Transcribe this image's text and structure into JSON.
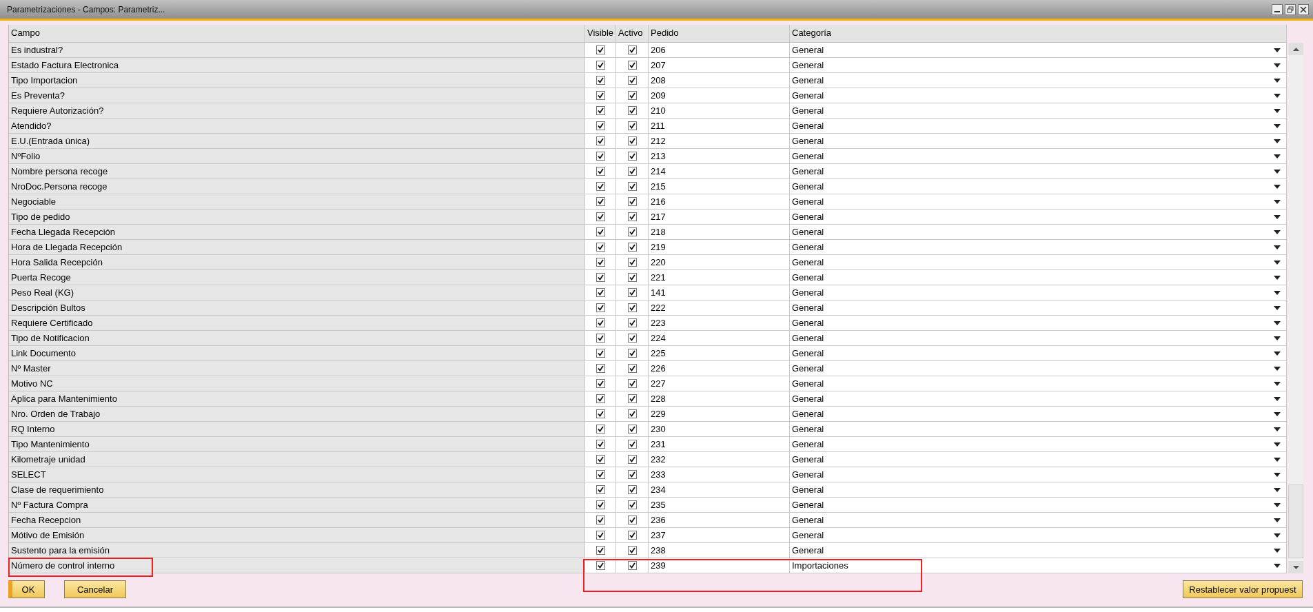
{
  "window": {
    "title": "Parametrizaciones - Campos: Parametriz..."
  },
  "table": {
    "columns": [
      "Campo",
      "Visible",
      "Activo",
      "Pedido",
      "Categoría"
    ],
    "rows": [
      {
        "campo": "Es industral?",
        "visible": true,
        "activo": true,
        "pedido": "206",
        "categoria": "General",
        "highlighted": false
      },
      {
        "campo": "Estado Factura Electronica",
        "visible": true,
        "activo": true,
        "pedido": "207",
        "categoria": "General",
        "highlighted": false
      },
      {
        "campo": "Tipo Importacion",
        "visible": true,
        "activo": true,
        "pedido": "208",
        "categoria": "General",
        "highlighted": false
      },
      {
        "campo": "Es Preventa?",
        "visible": true,
        "activo": true,
        "pedido": "209",
        "categoria": "General",
        "highlighted": false
      },
      {
        "campo": "Requiere Autorización?",
        "visible": true,
        "activo": true,
        "pedido": "210",
        "categoria": "General",
        "highlighted": false
      },
      {
        "campo": "Atendido?",
        "visible": true,
        "activo": true,
        "pedido": "211",
        "categoria": "General",
        "highlighted": false
      },
      {
        "campo": "E.U.(Entrada única)",
        "visible": true,
        "activo": true,
        "pedido": "212",
        "categoria": "General",
        "highlighted": false
      },
      {
        "campo": "NºFolio",
        "visible": true,
        "activo": true,
        "pedido": "213",
        "categoria": "General",
        "highlighted": false
      },
      {
        "campo": "Nombre persona recoge",
        "visible": true,
        "activo": true,
        "pedido": "214",
        "categoria": "General",
        "highlighted": false
      },
      {
        "campo": "NroDoc.Persona recoge",
        "visible": true,
        "activo": true,
        "pedido": "215",
        "categoria": "General",
        "highlighted": false
      },
      {
        "campo": "Negociable",
        "visible": true,
        "activo": true,
        "pedido": "216",
        "categoria": "General",
        "highlighted": false
      },
      {
        "campo": "Tipo de pedido",
        "visible": true,
        "activo": true,
        "pedido": "217",
        "categoria": "General",
        "highlighted": false
      },
      {
        "campo": "Fecha Llegada Recepción",
        "visible": true,
        "activo": true,
        "pedido": "218",
        "categoria": "General",
        "highlighted": false
      },
      {
        "campo": "Hora de Llegada Recepción",
        "visible": true,
        "activo": true,
        "pedido": "219",
        "categoria": "General",
        "highlighted": false
      },
      {
        "campo": "Hora Salida Recepción",
        "visible": true,
        "activo": true,
        "pedido": "220",
        "categoria": "General",
        "highlighted": false
      },
      {
        "campo": "Puerta Recoge",
        "visible": true,
        "activo": true,
        "pedido": "221",
        "categoria": "General",
        "highlighted": false
      },
      {
        "campo": "Peso Real (KG)",
        "visible": true,
        "activo": true,
        "pedido": "141",
        "categoria": "General",
        "highlighted": false
      },
      {
        "campo": "Descripción Bultos",
        "visible": true,
        "activo": true,
        "pedido": "222",
        "categoria": "General",
        "highlighted": false
      },
      {
        "campo": "Requiere Certificado",
        "visible": true,
        "activo": true,
        "pedido": "223",
        "categoria": "General",
        "highlighted": false
      },
      {
        "campo": "Tipo de Notificacion",
        "visible": true,
        "activo": true,
        "pedido": "224",
        "categoria": "General",
        "highlighted": false
      },
      {
        "campo": "Link Documento",
        "visible": true,
        "activo": true,
        "pedido": "225",
        "categoria": "General",
        "highlighted": false
      },
      {
        "campo": "Nº Master",
        "visible": true,
        "activo": true,
        "pedido": "226",
        "categoria": "General",
        "highlighted": false
      },
      {
        "campo": "Motivo NC",
        "visible": true,
        "activo": true,
        "pedido": "227",
        "categoria": "General",
        "highlighted": false
      },
      {
        "campo": "Aplica para Mantenimiento",
        "visible": true,
        "activo": true,
        "pedido": "228",
        "categoria": "General",
        "highlighted": false
      },
      {
        "campo": "Nro. Orden de Trabajo",
        "visible": true,
        "activo": true,
        "pedido": "229",
        "categoria": "General",
        "highlighted": false
      },
      {
        "campo": "RQ Interno",
        "visible": true,
        "activo": true,
        "pedido": "230",
        "categoria": "General",
        "highlighted": false
      },
      {
        "campo": "Tipo Mantenimiento",
        "visible": true,
        "activo": true,
        "pedido": "231",
        "categoria": "General",
        "highlighted": false
      },
      {
        "campo": "Kilometraje unidad",
        "visible": true,
        "activo": true,
        "pedido": "232",
        "categoria": "General",
        "highlighted": false
      },
      {
        "campo": "SELECT",
        "visible": true,
        "activo": true,
        "pedido": "233",
        "categoria": "General",
        "highlighted": false
      },
      {
        "campo": "Clase de requerimiento",
        "visible": true,
        "activo": true,
        "pedido": "234",
        "categoria": "General",
        "highlighted": false
      },
      {
        "campo": "Nº Factura Compra",
        "visible": true,
        "activo": true,
        "pedido": "235",
        "categoria": "General",
        "highlighted": false
      },
      {
        "campo": "Fecha Recepcion",
        "visible": true,
        "activo": true,
        "pedido": "236",
        "categoria": "General",
        "highlighted": false
      },
      {
        "campo": "Mótivo de Emisión",
        "visible": true,
        "activo": true,
        "pedido": "237",
        "categoria": "General",
        "highlighted": false
      },
      {
        "campo": "Sustento para la emisión",
        "visible": true,
        "activo": true,
        "pedido": "238",
        "categoria": "General",
        "highlighted": false
      },
      {
        "campo": "Número de control interno",
        "visible": true,
        "activo": true,
        "pedido": "239",
        "categoria": "Importaciones",
        "highlighted": true
      }
    ]
  },
  "buttons": {
    "ok": "OK",
    "cancel": "Cancelar",
    "reset": "Restablecer valor propuest"
  }
}
